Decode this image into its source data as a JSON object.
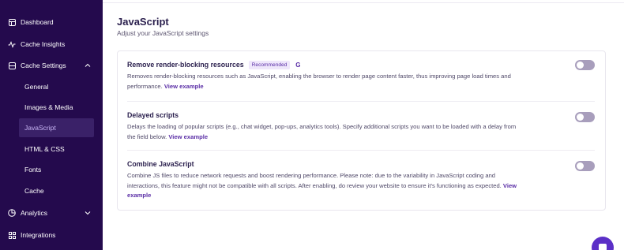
{
  "sidebar": {
    "items": [
      {
        "label": "Dashboard",
        "icon": "dashboard-icon"
      },
      {
        "label": "Cache Insights",
        "icon": "insights-icon"
      },
      {
        "label": "Cache Settings",
        "icon": "settings-icon"
      },
      {
        "label": "Analytics",
        "icon": "analytics-icon"
      },
      {
        "label": "Integrations",
        "icon": "integrations-icon"
      }
    ],
    "sub_items": [
      {
        "label": "General"
      },
      {
        "label": "Images & Media"
      },
      {
        "label": "JavaScript",
        "active": true
      },
      {
        "label": "HTML & CSS"
      },
      {
        "label": "Fonts"
      },
      {
        "label": "Cache"
      }
    ]
  },
  "header": {
    "title": "JavaScript",
    "subtitle": "Adjust your JavaScript settings"
  },
  "settings": [
    {
      "title": "Remove render-blocking resources",
      "badge": "Recommended",
      "badge_icon": "G",
      "desc": "Removes render-blocking resources such as JavaScript, enabling the browser to render page content faster, thus improving page load times and performance.",
      "link": "View example",
      "enabled": false
    },
    {
      "title": "Delayed scripts",
      "desc": "Delays the loading of popular scripts (e.g., chat widget, pop-ups, analytics tools). Specify additional scripts you want to be loaded with a delay from the field below.",
      "link": "View example",
      "enabled": false
    },
    {
      "title": "Combine JavaScript",
      "desc": "Combine JS files to reduce network requests and boost rendering performance. Please note: due to the variability in JavaScript coding and interactions, this feature might not be compatible with all scripts. After enabling, do review your website to ensure it's functioning as expected.",
      "link": "View example",
      "enabled": false
    }
  ],
  "colors": {
    "sidebar_bg": "#240a4d",
    "accent": "#5a2ea6",
    "toggle_off": "#a89ebc"
  }
}
